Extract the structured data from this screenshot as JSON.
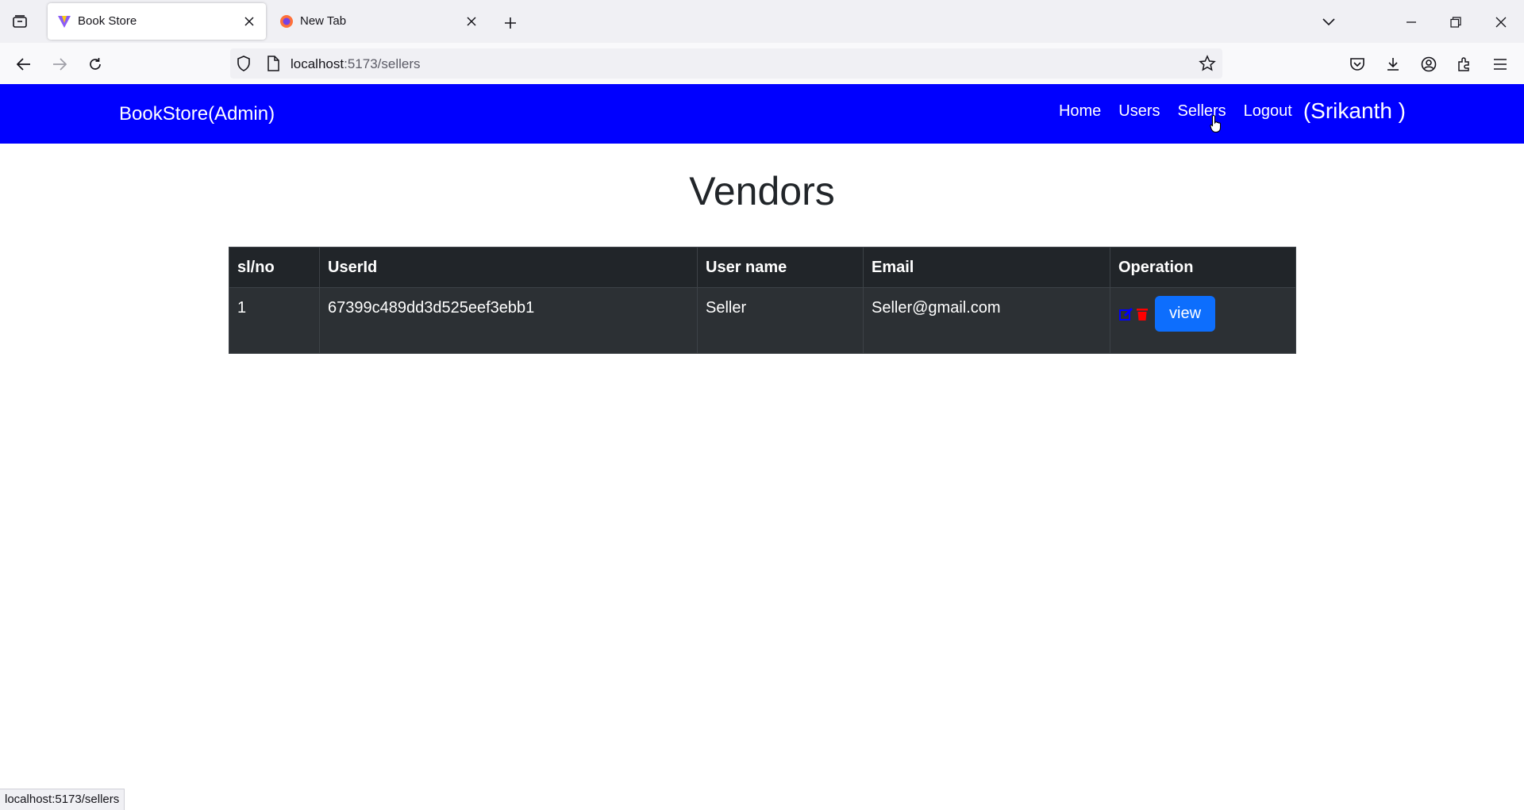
{
  "browser": {
    "tabs": [
      {
        "title": "Book Store",
        "active": true
      },
      {
        "title": "New Tab",
        "active": false
      }
    ],
    "url": {
      "host": "localhost",
      "rest": ":5173/sellers"
    },
    "status_url": "localhost:5173/sellers"
  },
  "header": {
    "brand": "BookStore(Admin)",
    "nav": [
      {
        "label": "Home"
      },
      {
        "label": "Users"
      },
      {
        "label": "Sellers"
      },
      {
        "label": "Logout"
      }
    ],
    "user": "(Srikanth )",
    "background_color": "#0000ff"
  },
  "page": {
    "title": "Vendors"
  },
  "table": {
    "columns": [
      "sl/no",
      "UserId",
      "User name",
      "Email",
      "Operation"
    ],
    "rows": [
      {
        "slno": "1",
        "userid": "67399c489dd3d525eef3ebb1",
        "username": "Seller",
        "email": "Seller@gmail.com",
        "view_label": "view"
      }
    ]
  },
  "colors": {
    "edit_icon": "#0000ff",
    "delete_icon": "#ff0000",
    "view_button": "#0d6efd"
  }
}
